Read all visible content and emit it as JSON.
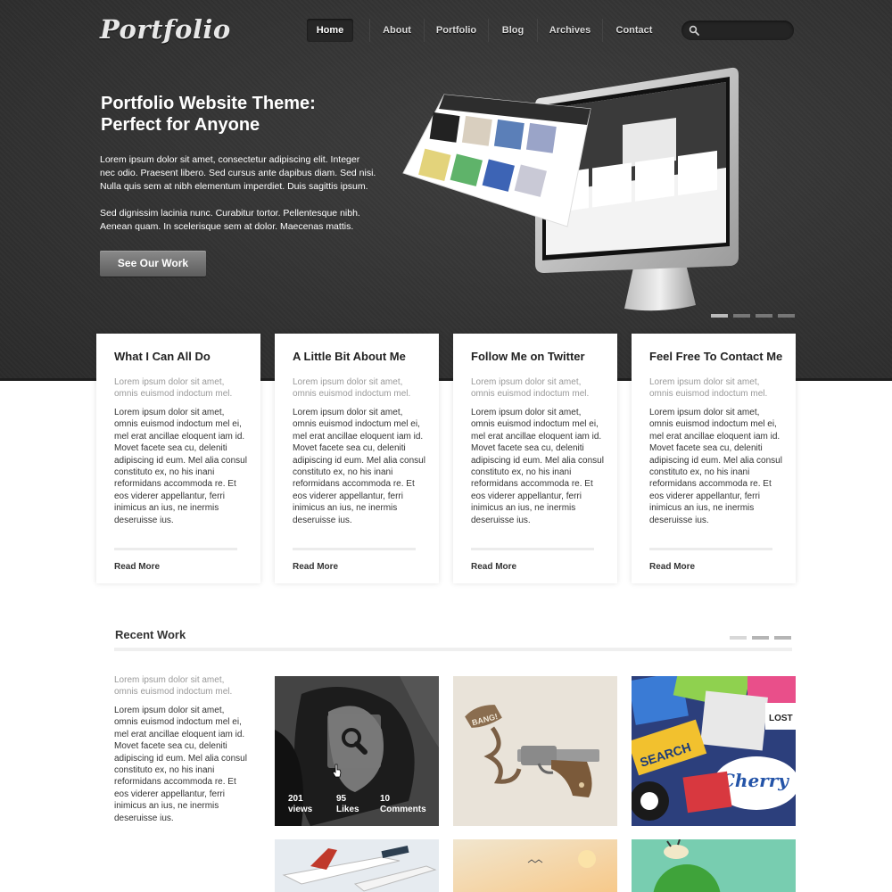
{
  "header": {
    "logo": "Portfolio",
    "nav": [
      "Home",
      "About",
      "Portfolio",
      "Blog",
      "Archives",
      "Contact"
    ],
    "active_nav": "Home",
    "search_placeholder": ""
  },
  "hero": {
    "title_line1": "Portfolio Website Theme:",
    "title_line2": "Perfect for Anyone",
    "paragraph1": "Lorem ipsum dolor sit amet, consectetur adipiscing elit. Integer nec odio. Praesent libero. Sed cursus ante dapibus diam. Sed nisi. Nulla quis sem at nibh elementum imperdiet. Duis sagittis ipsum.",
    "paragraph2": "Sed dignissim lacinia nunc. Curabitur tortor. Pellentesque nibh. Aenean quam. In scelerisque sem at dolor. Maecenas mattis.",
    "cta": "See Our Work",
    "slides_total": 4,
    "active_slide": 1
  },
  "boxes": [
    {
      "title": "What I Can All Do",
      "lead": "Lorem ipsum dolor sit amet, omnis euismod indoctum mel.",
      "body": "Lorem ipsum dolor sit amet, omnis euismod indoctum mel ei, mel erat ancillae eloquent iam id. Movet facete sea cu, deleniti adipiscing id eum. Mel alia consul constituto ex, no his inani reformidans accommoda re. Et eos viderer appellantur, ferri inimicus an ius, ne inermis deseruisse ius.",
      "link": "Read More"
    },
    {
      "title": "A Little Bit About Me",
      "lead": "Lorem ipsum dolor sit amet, omnis euismod indoctum mel.",
      "body": "Lorem ipsum dolor sit amet, omnis euismod indoctum mel ei, mel erat ancillae eloquent iam id. Movet facete sea cu, deleniti adipiscing id eum. Mel alia consul constituto ex, no his inani reformidans accommoda re. Et eos viderer appellantur, ferri inimicus an ius, ne inermis deseruisse ius.",
      "link": "Read More"
    },
    {
      "title": "Follow Me on Twitter",
      "lead": "Lorem ipsum dolor sit amet, omnis euismod indoctum mel.",
      "body": "Lorem ipsum dolor sit amet, omnis euismod indoctum mel ei, mel erat ancillae eloquent iam id. Movet facete sea cu, deleniti adipiscing id eum. Mel alia consul constituto ex, no his inani reformidans accommoda re. Et eos viderer appellantur, ferri inimicus an ius, ne inermis deseruisse ius.",
      "link": "Read More"
    },
    {
      "title": "Feel Free To Contact Me",
      "lead": "Lorem ipsum dolor sit amet, omnis euismod indoctum mel.",
      "body": "Lorem ipsum dolor sit amet, omnis euismod indoctum mel ei, mel erat ancillae eloquent iam id. Movet facete sea cu, deleniti adipiscing id eum. Mel alia consul constituto ex, no his inani reformidans accommoda re. Et eos viderer appellantur, ferri inimicus an ius, ne inermis deseruisse ius.",
      "link": "Read More"
    }
  ],
  "recent": {
    "title": "Recent Work",
    "lead": "Lorem ipsum dolor sit amet, omnis euismod indoctum mel.",
    "body": "Lorem ipsum dolor sit amet, omnis euismod indoctum mel ei, mel erat ancillae eloquent iam id. Movet facete sea cu, deleniti adipiscing id eum. Mel alia consul constituto ex, no his inani reformidans accommoda re. Et eos viderer appellantur, ferri inimicus an ius, ne inermis deseruisse ius.",
    "pages_total": 3,
    "active_page": 2,
    "hover_stats": {
      "views_count": "201",
      "views_label": "views",
      "likes_count": "95",
      "likes_label": "Likes",
      "comments_count": "10",
      "comments_label": "Comments"
    },
    "sticker_text": [
      "SEARCH",
      "Cherry",
      "LOST",
      "BANG!"
    ]
  },
  "icons": {
    "search": "search-icon",
    "zoom": "magnifier-icon",
    "cursor": "hand-pointer-icon"
  },
  "colors": {
    "header_bg": "#333333",
    "accent_button": "#6e6e6e",
    "text_dark": "#333333",
    "text_muted": "#999999"
  }
}
